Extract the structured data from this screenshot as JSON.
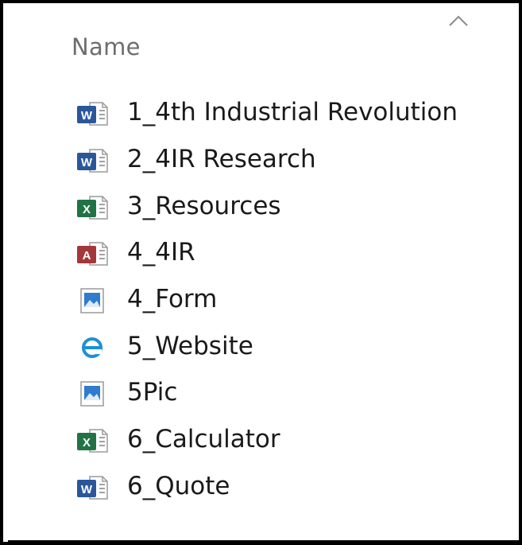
{
  "header": {
    "column_label": "Name",
    "sort_icon": "chevron-up-icon"
  },
  "files": [
    {
      "name": "1_4th Industrial Revolution",
      "icon": "word-doc-icon",
      "type": "word"
    },
    {
      "name": "2_4IR Research",
      "icon": "word-doc-icon",
      "type": "word"
    },
    {
      "name": "3_Resources",
      "icon": "excel-sheet-icon",
      "type": "excel"
    },
    {
      "name": "4_4IR",
      "icon": "access-db-icon",
      "type": "access"
    },
    {
      "name": "4_Form",
      "icon": "image-file-icon",
      "type": "image"
    },
    {
      "name": "5_Website",
      "icon": "internet-explorer-icon",
      "type": "ie"
    },
    {
      "name": "5Pic",
      "icon": "image-file-icon",
      "type": "image"
    },
    {
      "name": "6_Calculator",
      "icon": "excel-sheet-icon",
      "type": "excel"
    },
    {
      "name": "6_Quote",
      "icon": "word-doc-icon",
      "type": "word"
    }
  ],
  "colors": {
    "word": "#2b579a",
    "excel": "#217346",
    "access": "#a4373a",
    "image": "#2e7bcf",
    "ie": "#1e90d6",
    "header_text": "#6d6d6d",
    "file_text": "#1a1a1a"
  }
}
